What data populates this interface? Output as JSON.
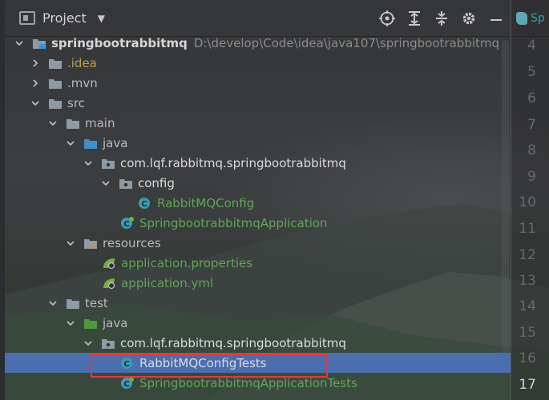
{
  "header": {
    "title": "Project",
    "icons": [
      "project-icon",
      "chevron-down-icon",
      "locate-icon",
      "expand-all-icon",
      "collapse-all-icon",
      "gear-icon",
      "minimize-icon"
    ]
  },
  "editor": {
    "tab_label": "Sp",
    "line_numbers": [
      "4",
      "5",
      "6",
      "7",
      "8",
      "9",
      "10",
      "11",
      "12",
      "13",
      "14",
      "15",
      "16",
      "17"
    ],
    "current_line": "17"
  },
  "tree": {
    "root_label": "springbootrabbitmq",
    "root_path": "D:\\develop\\Code\\idea\\java107\\springbootrabbitmq",
    "idea": ".idea",
    "mvn": ".mvn",
    "src": "src",
    "main": "main",
    "java_main": "java",
    "package_main": "com.lqf.rabbitmq.springbootrabbitmq",
    "config": "config",
    "rabbit_config": "RabbitMQConfig",
    "app_class": "SpringbootrabbitmqApplication",
    "resources": "resources",
    "app_properties": "application.properties",
    "app_yml": "application.yml",
    "test": "test",
    "java_test": "java",
    "package_test": "com.lqf.rabbitmq.springbootrabbitmq",
    "config_tests": "RabbitMQConfigTests",
    "app_tests": "SpringbootrabbitmqApplicationTests"
  },
  "colors": {
    "selection": "#4b6eaf",
    "highlight_border": "#e23b3b",
    "green_text": "#62a55a",
    "class_icon": "#3d9bb0"
  }
}
